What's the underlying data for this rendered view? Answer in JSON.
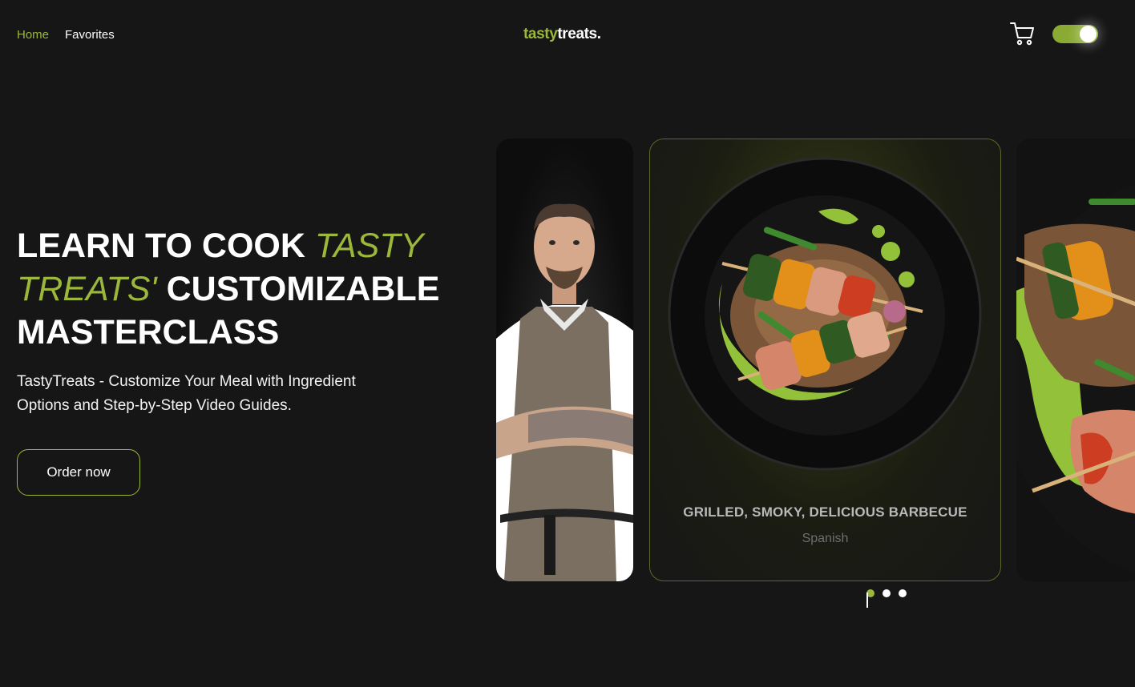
{
  "header": {
    "nav": [
      {
        "label": "Home",
        "active": true
      },
      {
        "label": "Favorites",
        "active": false
      }
    ],
    "logo": {
      "part1": "tasty",
      "part2": "treats."
    },
    "cart_icon": "cart-icon",
    "theme_toggle": {
      "on": true
    }
  },
  "hero": {
    "title_line1": "LEARN TO COOK ",
    "title_accent": "TASTY TREATS'",
    "title_rest": " CUSTOMIZABLE MASTERCLASS",
    "description": "TastyTreats - Customize Your Meal with Ingredient Options and Step-by-Step Video Guides.",
    "order_button": "Order now"
  },
  "slider": {
    "center_card": {
      "title": "GRILLED, SMOKY, DELICIOUS BARBECUE",
      "subtitle": "Spanish"
    },
    "dots": 3,
    "active_dot": 0
  },
  "colors": {
    "accent": "#9bb83a",
    "background": "#161616"
  }
}
